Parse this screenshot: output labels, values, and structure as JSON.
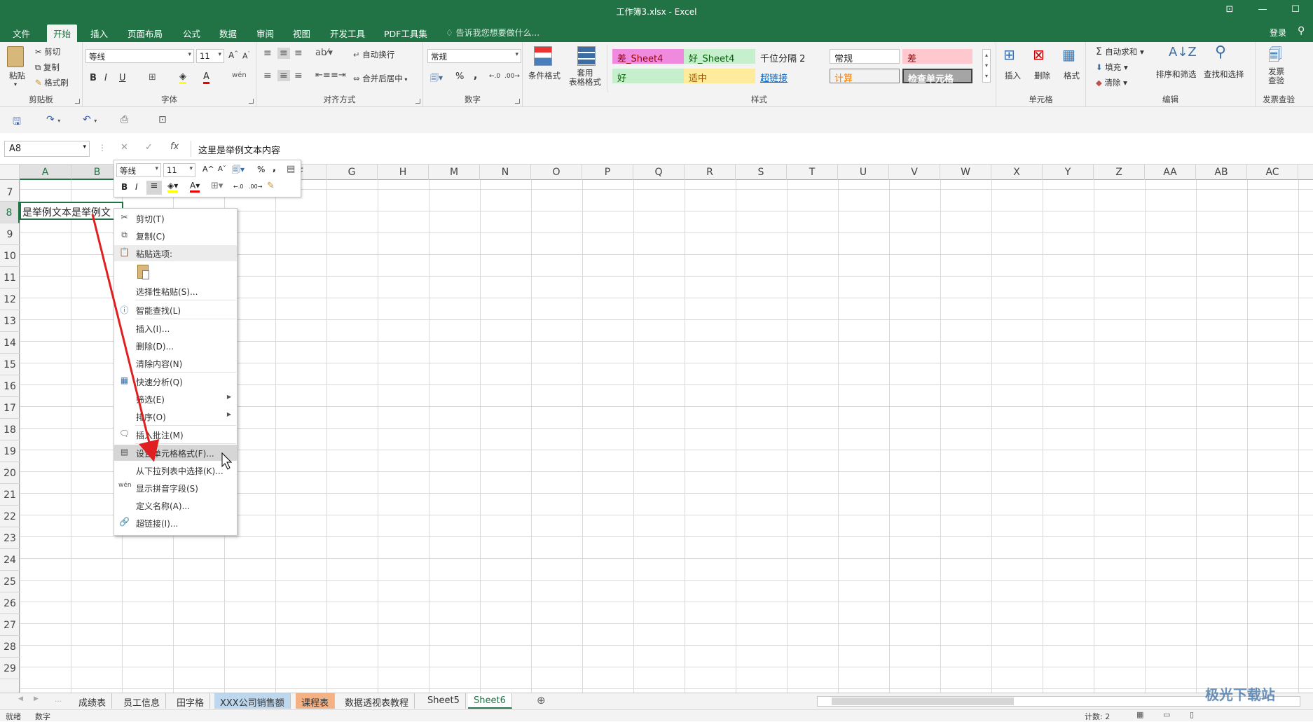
{
  "window": {
    "title": "工作簿3.xlsx - Excel",
    "login": "登录"
  },
  "tabs": [
    "文件",
    "开始",
    "插入",
    "页面布局",
    "公式",
    "数据",
    "审阅",
    "视图",
    "开发工具",
    "PDF工具集"
  ],
  "tellme": "告诉我您想要做什么...",
  "ribbon": {
    "clipboard": {
      "label": "剪贴板",
      "paste": "粘贴",
      "cut": "剪切",
      "copy": "复制",
      "format_painter": "格式刷"
    },
    "font": {
      "label": "字体",
      "name": "等线",
      "size": "11"
    },
    "alignment": {
      "label": "对齐方式",
      "wrap": "自动换行",
      "merge": "合并后居中"
    },
    "number": {
      "label": "数字",
      "format": "常规"
    },
    "styles": {
      "label": "样式",
      "conditional": "条件格式",
      "table": "套用\n表格格式",
      "cells": [
        {
          "text": "差_Sheet4",
          "bg": "#f08adf",
          "fg": "#9c0006"
        },
        {
          "text": "好_Sheet4",
          "bg": "#c6efce",
          "fg": "#006100"
        },
        {
          "text": "千位分隔 2",
          "bg": "#f3f3f3",
          "fg": "#222222"
        },
        {
          "text": "常规",
          "bg": "#ffffff",
          "fg": "#222222"
        },
        {
          "text": "差",
          "bg": "#ffc7ce",
          "fg": "#9c0006"
        },
        {
          "text": "好",
          "bg": "#c6efce",
          "fg": "#006100"
        },
        {
          "text": "适中",
          "bg": "#ffeb9c",
          "fg": "#9c5700"
        },
        {
          "text": "超链接",
          "bg": "#f3f3f3",
          "fg": "#0563c1"
        },
        {
          "text": "计算",
          "bg": "#f2f2f2",
          "fg": "#fa7d00"
        },
        {
          "text": "检查单元格",
          "bg": "#a5a5a5",
          "fg": "#ffffff"
        }
      ]
    },
    "cells_group": {
      "label": "单元格",
      "insert": "插入",
      "delete": "删除",
      "format": "格式"
    },
    "editing": {
      "label": "编辑",
      "autosum": "自动求和",
      "fill": "填充",
      "clear": "清除",
      "sort": "排序和筛选",
      "find": "查找和选择"
    },
    "invoice": {
      "label": "发票查验",
      "btn": "发票\n查验"
    }
  },
  "formula": {
    "namebox": "A8",
    "content": "这里是举例文本内容"
  },
  "columns": [
    "A",
    "B",
    "C",
    "D",
    "E",
    "F",
    "G",
    "H",
    "M",
    "N",
    "O",
    "P",
    "Q",
    "R",
    "S",
    "T",
    "U",
    "V",
    "W",
    "X",
    "Y",
    "Z",
    "AA",
    "AB",
    "AC"
  ],
  "rows": [
    "7",
    "8",
    "9",
    "10",
    "11",
    "12",
    "13",
    "14",
    "15",
    "16",
    "17",
    "18",
    "19",
    "20",
    "21",
    "22",
    "23",
    "24",
    "25",
    "26",
    "27",
    "28",
    "29"
  ],
  "cell_a8": "是举例文本是举例文",
  "mini_toolbar": {
    "font": "等线",
    "size": "11"
  },
  "context_menu": {
    "items": [
      {
        "label": "剪切(T)",
        "icon": "scissors-icon"
      },
      {
        "label": "复制(C)",
        "icon": "copy-icon"
      },
      {
        "label": "粘贴选项:",
        "icon": "paste-icon"
      },
      {
        "label": "",
        "icon": "paste-clipboard-icon"
      },
      {
        "label": "选择性粘贴(S)...",
        "icon": ""
      },
      {
        "label": "智能查找(L)",
        "icon": "info-icon"
      },
      {
        "label": "插入(I)...",
        "icon": ""
      },
      {
        "label": "删除(D)...",
        "icon": ""
      },
      {
        "label": "清除内容(N)",
        "icon": ""
      },
      {
        "label": "快速分析(Q)",
        "icon": "quick-analysis-icon"
      },
      {
        "label": "筛选(E)",
        "icon": ""
      },
      {
        "label": "排序(O)",
        "icon": ""
      },
      {
        "label": "插入批注(M)",
        "icon": "comment-icon"
      },
      {
        "label": "设置单元格格式(F)...",
        "icon": "format-cells-icon"
      },
      {
        "label": "从下拉列表中选择(K)...",
        "icon": ""
      },
      {
        "label": "显示拼音字段(S)",
        "icon": "phonetic-icon"
      },
      {
        "label": "定义名称(A)...",
        "icon": ""
      },
      {
        "label": "超链接(I)...",
        "icon": "hyperlink-icon"
      }
    ]
  },
  "sheets": [
    {
      "name": "成绩表",
      "bg": "#f3f3f3"
    },
    {
      "name": "员工信息",
      "bg": "#f3f3f3"
    },
    {
      "name": "田字格",
      "bg": "#f3f3f3"
    },
    {
      "name": "XXX公司销售额",
      "bg": "#bdd7ee"
    },
    {
      "name": "课程表",
      "bg": "#f4b183"
    },
    {
      "name": "数据透视表教程",
      "bg": "#f3f3f3"
    },
    {
      "name": "Sheet5",
      "bg": "#f3f3f3"
    },
    {
      "name": "Sheet6",
      "bg": "#ffffff"
    }
  ],
  "status": {
    "ready": "就绪",
    "numlock": "数字",
    "count": "计数: 2"
  },
  "watermark": "极光下载站"
}
